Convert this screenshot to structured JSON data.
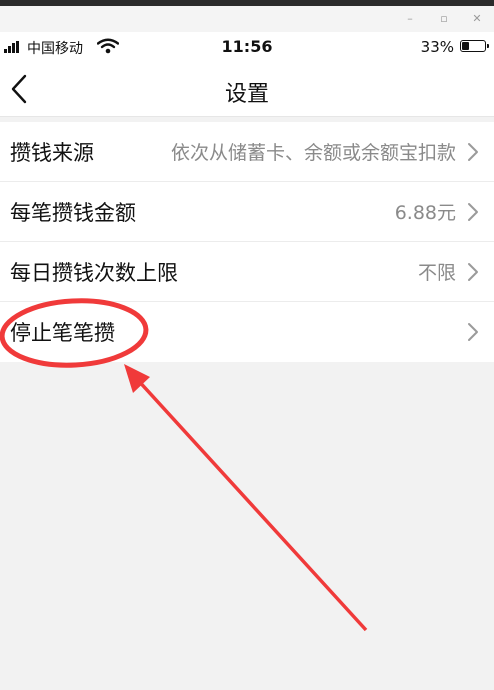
{
  "window": {
    "minimize_glyph": "–",
    "maximize_glyph": "▫",
    "close_glyph": "✕"
  },
  "status_bar": {
    "carrier": "中国移动",
    "time": "11:56",
    "battery_percent": "33%",
    "battery_level": 0.33
  },
  "nav": {
    "title": "设置"
  },
  "settings": [
    {
      "label": "攒钱来源",
      "value": "依次从储蓄卡、余额或余额宝扣款"
    },
    {
      "label": "每笔攒钱金额",
      "value": "6.88元"
    },
    {
      "label": "每日攒钱次数上限",
      "value": "不限"
    },
    {
      "label": "停止笔笔攒",
      "value": ""
    }
  ],
  "colors": {
    "annotation": "#f03a3a",
    "accent_text": "#111111",
    "secondary_text": "#8a8a8a"
  }
}
